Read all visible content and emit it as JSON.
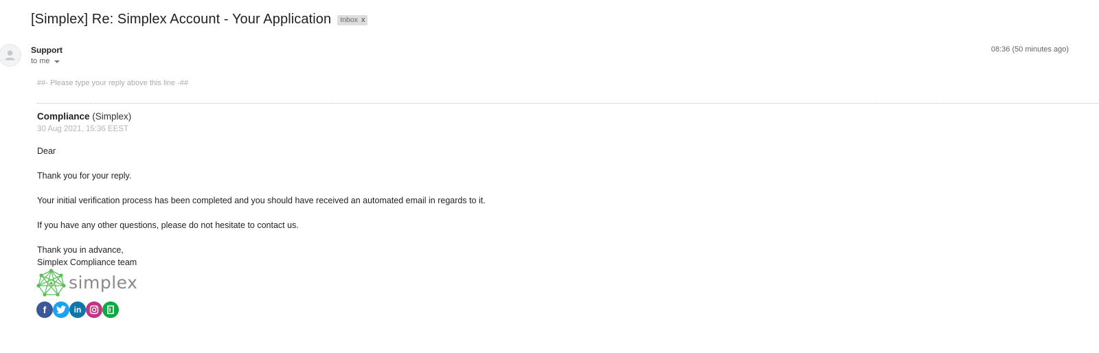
{
  "email": {
    "subject": "[Simplex] Re: Simplex Account - Your Application",
    "label": "Inbox",
    "label_close": "x",
    "sender": "Support",
    "recipient": "to me",
    "timestamp": "08:36 (50 minutes ago)"
  },
  "body": {
    "reply_line": "##- Please type your reply above this line -##",
    "author_name": "Compliance",
    "author_org": "(Simplex)",
    "date": "30 Aug 2021, 15:36 EEST",
    "lines": {
      "greeting": "Dear",
      "thanks": "Thank you for your reply.",
      "verification": "Your initial verification process has been completed and you should have received an automated email in regards to it.",
      "questions": "If you have any other questions, please do not hesitate to contact us.",
      "closing": "Thank you in advance,",
      "signature": "Simplex Compliance team"
    },
    "logo_text": "simplex"
  },
  "social": [
    {
      "name": "facebook-icon",
      "glyph": "f",
      "color": "#3b5998"
    },
    {
      "name": "twitter-icon",
      "glyph": "",
      "color": "#1da1f2"
    },
    {
      "name": "linkedin-icon",
      "glyph": "in",
      "color": "#0e76a8"
    },
    {
      "name": "instagram-icon",
      "glyph": "",
      "color": "#c13584"
    },
    {
      "name": "glassdoor-icon",
      "glyph": "",
      "color": "#0caa41"
    }
  ],
  "colors": {
    "logo_green": "#5bbf5b",
    "logo_text": "#8a8a8a",
    "label_bg": "#dddddd"
  }
}
